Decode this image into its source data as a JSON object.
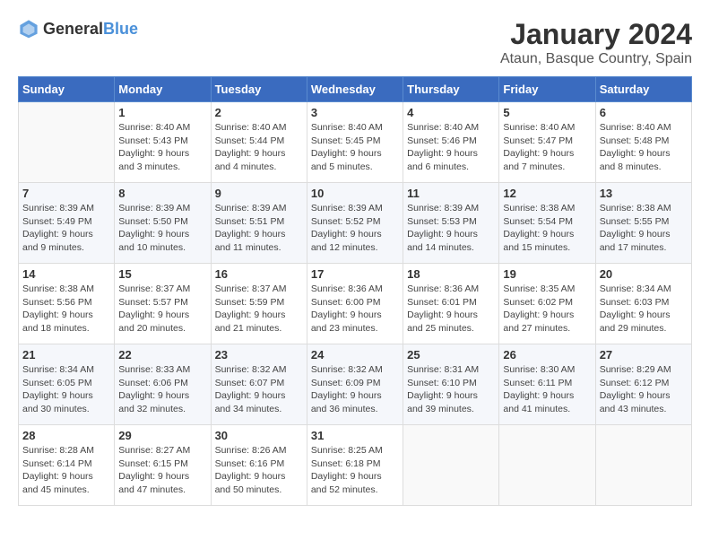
{
  "logo": {
    "general": "General",
    "blue": "Blue"
  },
  "title": "January 2024",
  "subtitle": "Ataun, Basque Country, Spain",
  "days_of_week": [
    "Sunday",
    "Monday",
    "Tuesday",
    "Wednesday",
    "Thursday",
    "Friday",
    "Saturday"
  ],
  "weeks": [
    [
      {
        "day": "",
        "sunrise": "",
        "sunset": "",
        "daylight": ""
      },
      {
        "day": "1",
        "sunrise": "Sunrise: 8:40 AM",
        "sunset": "Sunset: 5:43 PM",
        "daylight": "Daylight: 9 hours and 3 minutes."
      },
      {
        "day": "2",
        "sunrise": "Sunrise: 8:40 AM",
        "sunset": "Sunset: 5:44 PM",
        "daylight": "Daylight: 9 hours and 4 minutes."
      },
      {
        "day": "3",
        "sunrise": "Sunrise: 8:40 AM",
        "sunset": "Sunset: 5:45 PM",
        "daylight": "Daylight: 9 hours and 5 minutes."
      },
      {
        "day": "4",
        "sunrise": "Sunrise: 8:40 AM",
        "sunset": "Sunset: 5:46 PM",
        "daylight": "Daylight: 9 hours and 6 minutes."
      },
      {
        "day": "5",
        "sunrise": "Sunrise: 8:40 AM",
        "sunset": "Sunset: 5:47 PM",
        "daylight": "Daylight: 9 hours and 7 minutes."
      },
      {
        "day": "6",
        "sunrise": "Sunrise: 8:40 AM",
        "sunset": "Sunset: 5:48 PM",
        "daylight": "Daylight: 9 hours and 8 minutes."
      }
    ],
    [
      {
        "day": "7",
        "sunrise": "Sunrise: 8:39 AM",
        "sunset": "Sunset: 5:49 PM",
        "daylight": "Daylight: 9 hours and 9 minutes."
      },
      {
        "day": "8",
        "sunrise": "Sunrise: 8:39 AM",
        "sunset": "Sunset: 5:50 PM",
        "daylight": "Daylight: 9 hours and 10 minutes."
      },
      {
        "day": "9",
        "sunrise": "Sunrise: 8:39 AM",
        "sunset": "Sunset: 5:51 PM",
        "daylight": "Daylight: 9 hours and 11 minutes."
      },
      {
        "day": "10",
        "sunrise": "Sunrise: 8:39 AM",
        "sunset": "Sunset: 5:52 PM",
        "daylight": "Daylight: 9 hours and 12 minutes."
      },
      {
        "day": "11",
        "sunrise": "Sunrise: 8:39 AM",
        "sunset": "Sunset: 5:53 PM",
        "daylight": "Daylight: 9 hours and 14 minutes."
      },
      {
        "day": "12",
        "sunrise": "Sunrise: 8:38 AM",
        "sunset": "Sunset: 5:54 PM",
        "daylight": "Daylight: 9 hours and 15 minutes."
      },
      {
        "day": "13",
        "sunrise": "Sunrise: 8:38 AM",
        "sunset": "Sunset: 5:55 PM",
        "daylight": "Daylight: 9 hours and 17 minutes."
      }
    ],
    [
      {
        "day": "14",
        "sunrise": "Sunrise: 8:38 AM",
        "sunset": "Sunset: 5:56 PM",
        "daylight": "Daylight: 9 hours and 18 minutes."
      },
      {
        "day": "15",
        "sunrise": "Sunrise: 8:37 AM",
        "sunset": "Sunset: 5:57 PM",
        "daylight": "Daylight: 9 hours and 20 minutes."
      },
      {
        "day": "16",
        "sunrise": "Sunrise: 8:37 AM",
        "sunset": "Sunset: 5:59 PM",
        "daylight": "Daylight: 9 hours and 21 minutes."
      },
      {
        "day": "17",
        "sunrise": "Sunrise: 8:36 AM",
        "sunset": "Sunset: 6:00 PM",
        "daylight": "Daylight: 9 hours and 23 minutes."
      },
      {
        "day": "18",
        "sunrise": "Sunrise: 8:36 AM",
        "sunset": "Sunset: 6:01 PM",
        "daylight": "Daylight: 9 hours and 25 minutes."
      },
      {
        "day": "19",
        "sunrise": "Sunrise: 8:35 AM",
        "sunset": "Sunset: 6:02 PM",
        "daylight": "Daylight: 9 hours and 27 minutes."
      },
      {
        "day": "20",
        "sunrise": "Sunrise: 8:34 AM",
        "sunset": "Sunset: 6:03 PM",
        "daylight": "Daylight: 9 hours and 29 minutes."
      }
    ],
    [
      {
        "day": "21",
        "sunrise": "Sunrise: 8:34 AM",
        "sunset": "Sunset: 6:05 PM",
        "daylight": "Daylight: 9 hours and 30 minutes."
      },
      {
        "day": "22",
        "sunrise": "Sunrise: 8:33 AM",
        "sunset": "Sunset: 6:06 PM",
        "daylight": "Daylight: 9 hours and 32 minutes."
      },
      {
        "day": "23",
        "sunrise": "Sunrise: 8:32 AM",
        "sunset": "Sunset: 6:07 PM",
        "daylight": "Daylight: 9 hours and 34 minutes."
      },
      {
        "day": "24",
        "sunrise": "Sunrise: 8:32 AM",
        "sunset": "Sunset: 6:09 PM",
        "daylight": "Daylight: 9 hours and 36 minutes."
      },
      {
        "day": "25",
        "sunrise": "Sunrise: 8:31 AM",
        "sunset": "Sunset: 6:10 PM",
        "daylight": "Daylight: 9 hours and 39 minutes."
      },
      {
        "day": "26",
        "sunrise": "Sunrise: 8:30 AM",
        "sunset": "Sunset: 6:11 PM",
        "daylight": "Daylight: 9 hours and 41 minutes."
      },
      {
        "day": "27",
        "sunrise": "Sunrise: 8:29 AM",
        "sunset": "Sunset: 6:12 PM",
        "daylight": "Daylight: 9 hours and 43 minutes."
      }
    ],
    [
      {
        "day": "28",
        "sunrise": "Sunrise: 8:28 AM",
        "sunset": "Sunset: 6:14 PM",
        "daylight": "Daylight: 9 hours and 45 minutes."
      },
      {
        "day": "29",
        "sunrise": "Sunrise: 8:27 AM",
        "sunset": "Sunset: 6:15 PM",
        "daylight": "Daylight: 9 hours and 47 minutes."
      },
      {
        "day": "30",
        "sunrise": "Sunrise: 8:26 AM",
        "sunset": "Sunset: 6:16 PM",
        "daylight": "Daylight: 9 hours and 50 minutes."
      },
      {
        "day": "31",
        "sunrise": "Sunrise: 8:25 AM",
        "sunset": "Sunset: 6:18 PM",
        "daylight": "Daylight: 9 hours and 52 minutes."
      },
      {
        "day": "",
        "sunrise": "",
        "sunset": "",
        "daylight": ""
      },
      {
        "day": "",
        "sunrise": "",
        "sunset": "",
        "daylight": ""
      },
      {
        "day": "",
        "sunrise": "",
        "sunset": "",
        "daylight": ""
      }
    ]
  ]
}
